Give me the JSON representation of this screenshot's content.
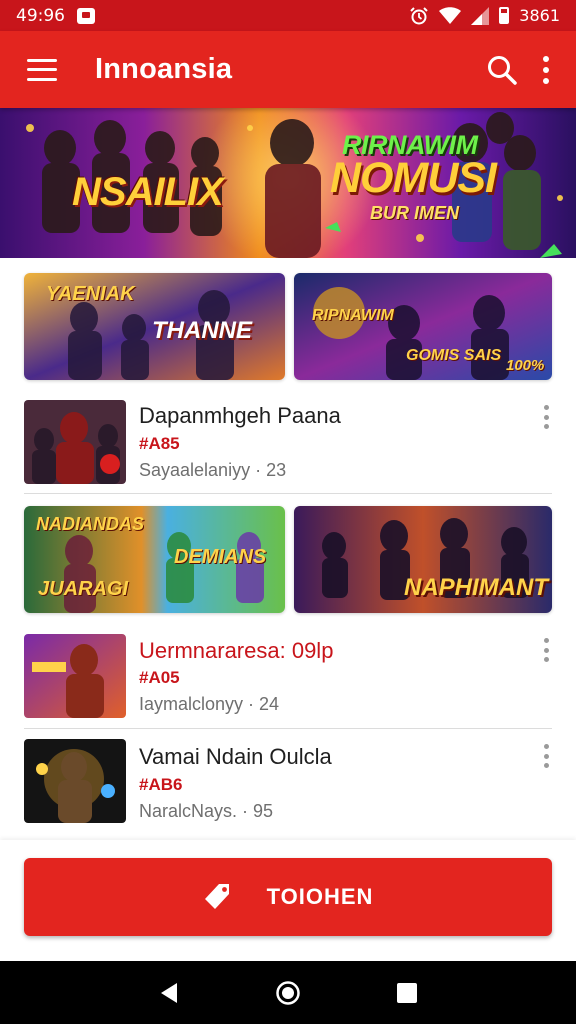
{
  "status_bar": {
    "time": "49:96",
    "level": "3861"
  },
  "app_bar": {
    "title": "Innoansia"
  },
  "hero": {
    "left_title": "NSAILIX",
    "right_top": "RIRNAWIM",
    "right_title": "NOMUSI",
    "right_sub": "BUR IMEN"
  },
  "tiles_row1": [
    {
      "label": "YAENIAK",
      "sub": "THANNE"
    },
    {
      "label": "RIPNAWIM",
      "sub": "GOMIS SAIS",
      "badge": "100%"
    }
  ],
  "list1": {
    "title": "Dapanmhgeh Paana",
    "code": "#A85",
    "meta": "Sayaalelaniyy · 23"
  },
  "tiles_row2": [
    {
      "label": "NADIANDAS",
      "sub": "DEMIANS",
      "sub2": "JUARAGI"
    },
    {
      "label": "NAPHIMANT"
    }
  ],
  "list2": {
    "title": "Uermnararesa: 09lp",
    "code": "#A05",
    "meta": "Iaymalclonyy · 24"
  },
  "list3": {
    "title": "Vamai Ndain Oulcla",
    "code": "#AB6",
    "meta": "NaralcNays. · 95"
  },
  "cta": {
    "label": "TOIOHEN"
  },
  "colors": {
    "primary": "#e3251f",
    "status": "#c8151b",
    "accent_text": "#c8151b"
  }
}
